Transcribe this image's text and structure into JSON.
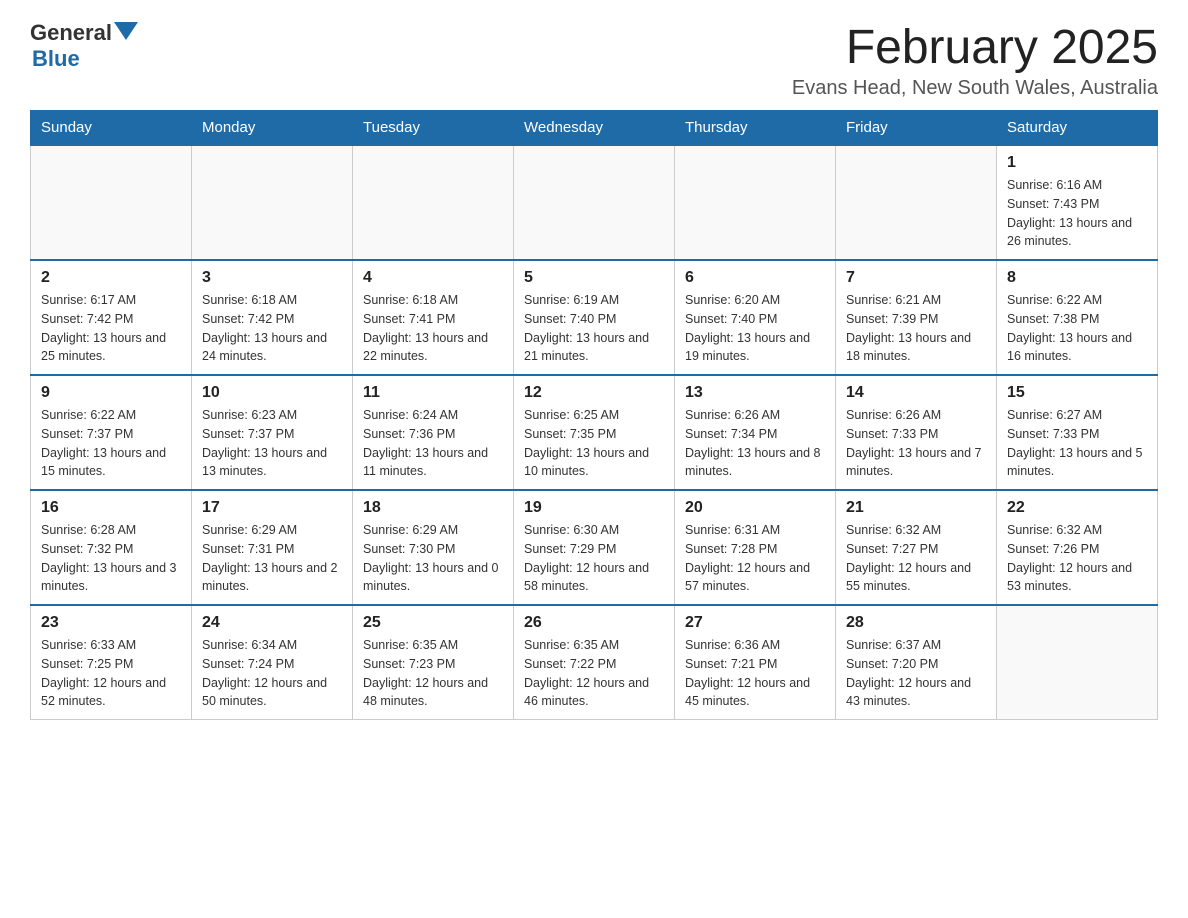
{
  "header": {
    "logo": {
      "general": "General",
      "arrow": "▼",
      "blue": "Blue"
    },
    "title": "February 2025",
    "subtitle": "Evans Head, New South Wales, Australia"
  },
  "days_of_week": [
    "Sunday",
    "Monday",
    "Tuesday",
    "Wednesday",
    "Thursday",
    "Friday",
    "Saturday"
  ],
  "weeks": [
    [
      {
        "day": "",
        "sunrise": "",
        "sunset": "",
        "daylight": ""
      },
      {
        "day": "",
        "sunrise": "",
        "sunset": "",
        "daylight": ""
      },
      {
        "day": "",
        "sunrise": "",
        "sunset": "",
        "daylight": ""
      },
      {
        "day": "",
        "sunrise": "",
        "sunset": "",
        "daylight": ""
      },
      {
        "day": "",
        "sunrise": "",
        "sunset": "",
        "daylight": ""
      },
      {
        "day": "",
        "sunrise": "",
        "sunset": "",
        "daylight": ""
      },
      {
        "day": "1",
        "sunrise": "Sunrise: 6:16 AM",
        "sunset": "Sunset: 7:43 PM",
        "daylight": "Daylight: 13 hours and 26 minutes."
      }
    ],
    [
      {
        "day": "2",
        "sunrise": "Sunrise: 6:17 AM",
        "sunset": "Sunset: 7:42 PM",
        "daylight": "Daylight: 13 hours and 25 minutes."
      },
      {
        "day": "3",
        "sunrise": "Sunrise: 6:18 AM",
        "sunset": "Sunset: 7:42 PM",
        "daylight": "Daylight: 13 hours and 24 minutes."
      },
      {
        "day": "4",
        "sunrise": "Sunrise: 6:18 AM",
        "sunset": "Sunset: 7:41 PM",
        "daylight": "Daylight: 13 hours and 22 minutes."
      },
      {
        "day": "5",
        "sunrise": "Sunrise: 6:19 AM",
        "sunset": "Sunset: 7:40 PM",
        "daylight": "Daylight: 13 hours and 21 minutes."
      },
      {
        "day": "6",
        "sunrise": "Sunrise: 6:20 AM",
        "sunset": "Sunset: 7:40 PM",
        "daylight": "Daylight: 13 hours and 19 minutes."
      },
      {
        "day": "7",
        "sunrise": "Sunrise: 6:21 AM",
        "sunset": "Sunset: 7:39 PM",
        "daylight": "Daylight: 13 hours and 18 minutes."
      },
      {
        "day": "8",
        "sunrise": "Sunrise: 6:22 AM",
        "sunset": "Sunset: 7:38 PM",
        "daylight": "Daylight: 13 hours and 16 minutes."
      }
    ],
    [
      {
        "day": "9",
        "sunrise": "Sunrise: 6:22 AM",
        "sunset": "Sunset: 7:37 PM",
        "daylight": "Daylight: 13 hours and 15 minutes."
      },
      {
        "day": "10",
        "sunrise": "Sunrise: 6:23 AM",
        "sunset": "Sunset: 7:37 PM",
        "daylight": "Daylight: 13 hours and 13 minutes."
      },
      {
        "day": "11",
        "sunrise": "Sunrise: 6:24 AM",
        "sunset": "Sunset: 7:36 PM",
        "daylight": "Daylight: 13 hours and 11 minutes."
      },
      {
        "day": "12",
        "sunrise": "Sunrise: 6:25 AM",
        "sunset": "Sunset: 7:35 PM",
        "daylight": "Daylight: 13 hours and 10 minutes."
      },
      {
        "day": "13",
        "sunrise": "Sunrise: 6:26 AM",
        "sunset": "Sunset: 7:34 PM",
        "daylight": "Daylight: 13 hours and 8 minutes."
      },
      {
        "day": "14",
        "sunrise": "Sunrise: 6:26 AM",
        "sunset": "Sunset: 7:33 PM",
        "daylight": "Daylight: 13 hours and 7 minutes."
      },
      {
        "day": "15",
        "sunrise": "Sunrise: 6:27 AM",
        "sunset": "Sunset: 7:33 PM",
        "daylight": "Daylight: 13 hours and 5 minutes."
      }
    ],
    [
      {
        "day": "16",
        "sunrise": "Sunrise: 6:28 AM",
        "sunset": "Sunset: 7:32 PM",
        "daylight": "Daylight: 13 hours and 3 minutes."
      },
      {
        "day": "17",
        "sunrise": "Sunrise: 6:29 AM",
        "sunset": "Sunset: 7:31 PM",
        "daylight": "Daylight: 13 hours and 2 minutes."
      },
      {
        "day": "18",
        "sunrise": "Sunrise: 6:29 AM",
        "sunset": "Sunset: 7:30 PM",
        "daylight": "Daylight: 13 hours and 0 minutes."
      },
      {
        "day": "19",
        "sunrise": "Sunrise: 6:30 AM",
        "sunset": "Sunset: 7:29 PM",
        "daylight": "Daylight: 12 hours and 58 minutes."
      },
      {
        "day": "20",
        "sunrise": "Sunrise: 6:31 AM",
        "sunset": "Sunset: 7:28 PM",
        "daylight": "Daylight: 12 hours and 57 minutes."
      },
      {
        "day": "21",
        "sunrise": "Sunrise: 6:32 AM",
        "sunset": "Sunset: 7:27 PM",
        "daylight": "Daylight: 12 hours and 55 minutes."
      },
      {
        "day": "22",
        "sunrise": "Sunrise: 6:32 AM",
        "sunset": "Sunset: 7:26 PM",
        "daylight": "Daylight: 12 hours and 53 minutes."
      }
    ],
    [
      {
        "day": "23",
        "sunrise": "Sunrise: 6:33 AM",
        "sunset": "Sunset: 7:25 PM",
        "daylight": "Daylight: 12 hours and 52 minutes."
      },
      {
        "day": "24",
        "sunrise": "Sunrise: 6:34 AM",
        "sunset": "Sunset: 7:24 PM",
        "daylight": "Daylight: 12 hours and 50 minutes."
      },
      {
        "day": "25",
        "sunrise": "Sunrise: 6:35 AM",
        "sunset": "Sunset: 7:23 PM",
        "daylight": "Daylight: 12 hours and 48 minutes."
      },
      {
        "day": "26",
        "sunrise": "Sunrise: 6:35 AM",
        "sunset": "Sunset: 7:22 PM",
        "daylight": "Daylight: 12 hours and 46 minutes."
      },
      {
        "day": "27",
        "sunrise": "Sunrise: 6:36 AM",
        "sunset": "Sunset: 7:21 PM",
        "daylight": "Daylight: 12 hours and 45 minutes."
      },
      {
        "day": "28",
        "sunrise": "Sunrise: 6:37 AM",
        "sunset": "Sunset: 7:20 PM",
        "daylight": "Daylight: 12 hours and 43 minutes."
      },
      {
        "day": "",
        "sunrise": "",
        "sunset": "",
        "daylight": ""
      }
    ]
  ]
}
